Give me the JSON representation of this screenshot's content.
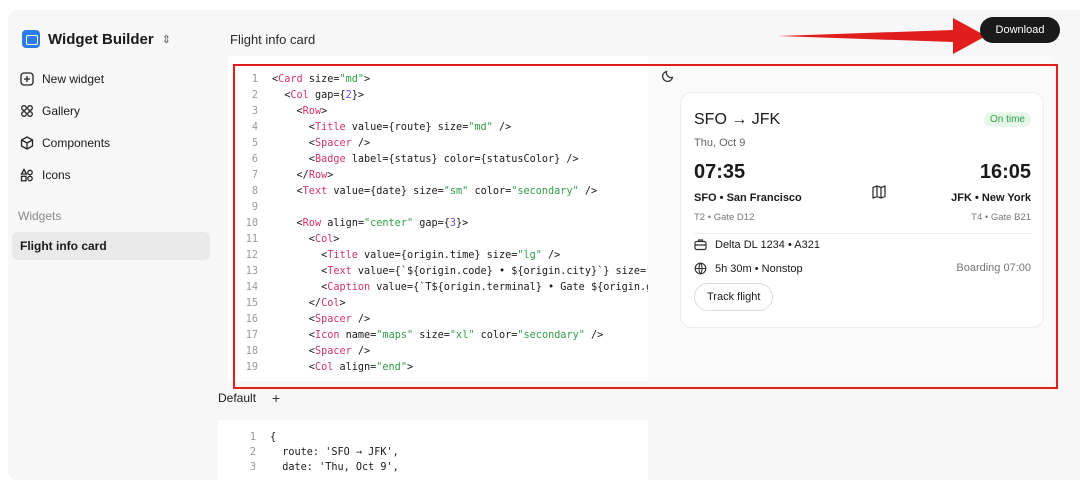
{
  "app": {
    "name": "Widget Builder"
  },
  "sidebar": {
    "items": [
      {
        "label": "New widget",
        "icon": "plus-square-icon"
      },
      {
        "label": "Gallery",
        "icon": "grid-icon"
      },
      {
        "label": "Components",
        "icon": "cube-icon"
      },
      {
        "label": "Icons",
        "icon": "shapes-icon"
      }
    ],
    "section_label": "Widgets",
    "widgets": [
      {
        "label": "Flight info card",
        "selected": true
      }
    ]
  },
  "header": {
    "title": "Flight info card",
    "download_label": "Download"
  },
  "code": {
    "line_numbers": [
      "1",
      "2",
      "3",
      "4",
      "5",
      "6",
      "7",
      "8",
      "9",
      "10",
      "11",
      "12",
      "13",
      "14",
      "15",
      "16",
      "17",
      "18",
      "19"
    ],
    "lines": [
      "<Card size=\"md\">",
      "  <Col gap={2}>",
      "    <Row>",
      "      <Title value={route} size=\"md\" />",
      "      <Spacer />",
      "      <Badge label={status} color={statusColor} />",
      "    </Row>",
      "    <Text value={date} size=\"sm\" color=\"secondary\" />",
      "",
      "    <Row align=\"center\" gap={3}>",
      "      <Col>",
      "        <Title value={origin.time} size=\"lg\" />",
      "        <Text value={`${origin.code} • ${origin.city}`} size=\"sm\" weight=\"sem",
      "        <Caption value={`T${origin.terminal} • Gate ${origin.gate}`} />",
      "      </Col>",
      "      <Spacer />",
      "      <Icon name=\"maps\" size=\"xl\" color=\"secondary\" />",
      "      <Spacer />",
      "      <Col align=\"end\">"
    ]
  },
  "preview": {
    "theme_icon": "moon-icon",
    "route": "SFO → JFK",
    "status": "On time",
    "date": "Thu, Oct 9",
    "origin": {
      "time": "07:35",
      "city": "SFO • San Francisco",
      "gate": "T2 • Gate D12"
    },
    "destination": {
      "time": "16:05",
      "city": "JFK • New York",
      "gate": "T4 • Gate B21"
    },
    "map_icon": "map-icon",
    "flight": "Delta DL 1234 • A321",
    "duration": "5h 30m • Nonstop",
    "boarding": "Boarding 07:00",
    "track_label": "Track flight"
  },
  "data_panel": {
    "tab_label": "Default",
    "add_label": "+",
    "line_numbers": [
      "1",
      "2",
      "3"
    ],
    "lines": [
      "{",
      "  route: 'SFO → JFK',",
      "  date: 'Thu, Oct 9',"
    ]
  },
  "colors": {
    "highlight": "#e01e1e",
    "accent": "#2b7de9",
    "badge_text": "#2f9e44",
    "download_bg": "#1a1a1a"
  }
}
